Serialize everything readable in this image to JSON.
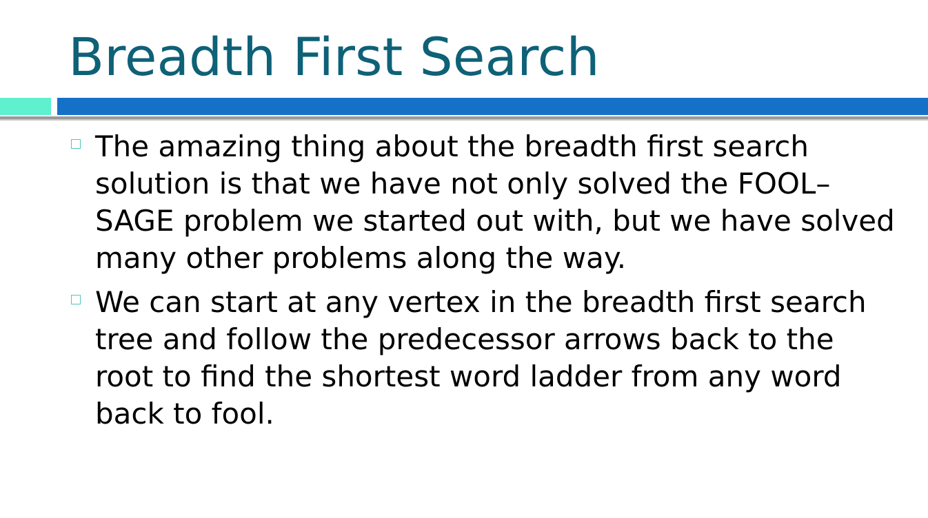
{
  "slide": {
    "title": "Breadth First Search",
    "bullets": [
      {
        "text": "The amazing thing about the breadth first search solution is that we have not only solved the FOOL–SAGE problem we started out with, but we have solved many other problems along the way."
      },
      {
        "text": "We can start at any vertex in the breadth first search tree and follow the predecessor arrows back to the root to find the shortest word ladder from any word back to fool."
      }
    ],
    "colors": {
      "title": "#0e6177",
      "accent_bar": "#5ef0cf",
      "main_bar": "#1571c8",
      "bullet_marker": "#4cc9b8"
    },
    "bullet_marker_icon": "hollow-square-bullet-icon"
  }
}
